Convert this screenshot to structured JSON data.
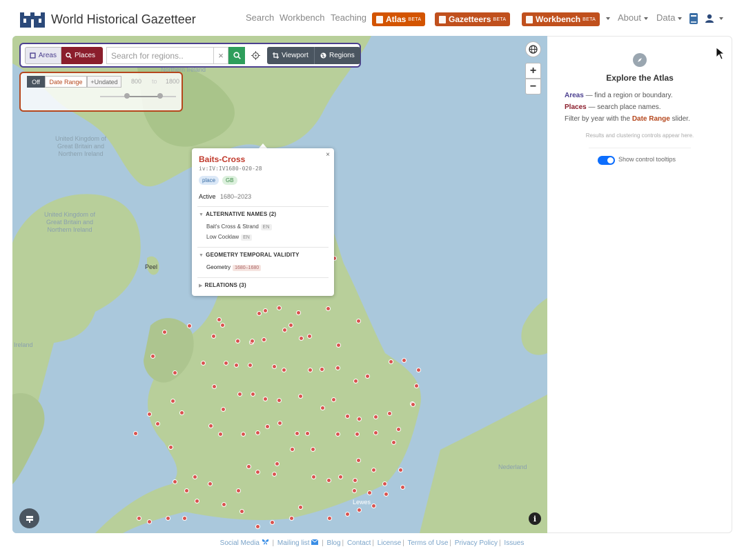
{
  "brand": {
    "title": "World Historical Gazetteer"
  },
  "nav": {
    "links": [
      "Search",
      "Workbench",
      "Teaching"
    ],
    "buttons": [
      {
        "label": "Atlas",
        "beta": "BETA",
        "color": "#d35400"
      },
      {
        "label": "Gazetteers",
        "beta": "BETA",
        "color": "#c0501d"
      },
      {
        "label": "Workbench",
        "beta": "BETA",
        "color": "#c0501d"
      }
    ],
    "about": "About",
    "data": "Data"
  },
  "search": {
    "areas_label": "Areas",
    "places_label": "Places",
    "placeholder": "Search for regions..",
    "clear": "×",
    "viewport_label": "Viewport",
    "regions_label": "Regions"
  },
  "date_range": {
    "off_label": "Off",
    "range_label": "Date Range",
    "undated_label": "+Undated",
    "from": "800",
    "to_word": "to",
    "to": "1800"
  },
  "map_labels": {
    "uk1": [
      "United Kingdom of",
      "Great Britain and",
      "Northern Ireland"
    ],
    "uk2": [
      "United Kingdom of",
      "Great Britain and",
      "Northern Ireland"
    ],
    "northern_ireland": "Northern Ireland",
    "ireland": "Ireland",
    "peel": "Peel",
    "netherlands": "Nederland",
    "lewes": "Lewes"
  },
  "popup": {
    "title": "Baits-Cross",
    "id": "iv:IV:IV1680-020-28",
    "badges": [
      "place",
      "GB"
    ],
    "active_label": "Active",
    "active_range": "1680–2023",
    "alt_names_header": "ALTERNATIVE NAMES (2)",
    "alt_names": [
      {
        "name": "Bait's Cross & Strand",
        "lang": "EN"
      },
      {
        "name": "Low Cocklaw",
        "lang": "EN"
      }
    ],
    "geom_header": "GEOMETRY TEMPORAL VALIDITY",
    "geom_label": "Geometry",
    "geom_range": "1680–1680",
    "relations_header": "RELATIONS (3)",
    "close": "×"
  },
  "side": {
    "title": "Explore the Atlas",
    "areas_word": "Areas",
    "areas_text": " — find a region or boundary.",
    "places_word": "Places",
    "places_text": " — search place names.",
    "filter_prefix": "Filter by year with the ",
    "filter_word": "Date Range",
    "filter_suffix": " slider.",
    "note": "Results and clustering controls appear here.",
    "toggle_label": "Show control tooltips"
  },
  "footer": {
    "links": [
      "Social Media",
      "Mailing list",
      "Blog",
      "Contact",
      "License",
      "Terms of Use",
      "Privacy Policy",
      "Issues"
    ]
  }
}
